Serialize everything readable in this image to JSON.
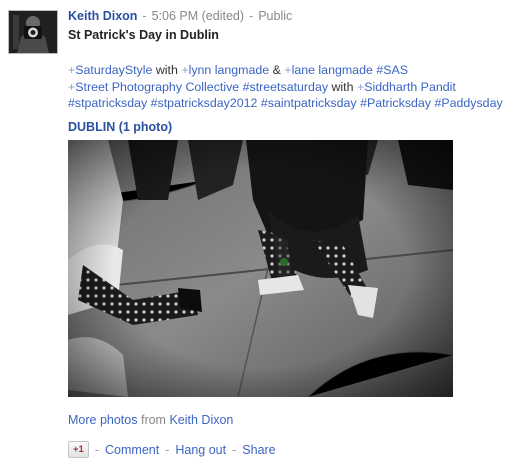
{
  "post": {
    "author": "Keith Dixon",
    "time": "5:06 PM (edited)",
    "visibility": "Public",
    "title": "St Patrick's Day in Dublin"
  },
  "tags": {
    "line1": [
      {
        "text": "+SaturdayStyle",
        "link": true
      },
      {
        "text": " with ",
        "link": false
      },
      {
        "text": "+lynn langmade",
        "link": true
      },
      {
        "text": " & ",
        "link": false
      },
      {
        "text": "+lane langmade",
        "link": true
      },
      {
        "text": " ",
        "link": false
      },
      {
        "text": "#SAS",
        "link": true
      }
    ],
    "line2": [
      {
        "text": "+Street Photography Collective",
        "link": true
      },
      {
        "text": " ",
        "link": false
      },
      {
        "text": "#streetsaturday",
        "link": true
      },
      {
        "text": " with ",
        "link": false
      },
      {
        "text": "+Siddharth Pandit",
        "link": true
      }
    ],
    "line3": [
      {
        "text": "#stpatricksday",
        "link": true
      },
      {
        "text": " ",
        "link": false
      },
      {
        "text": "#stpatricksday2012",
        "link": true
      },
      {
        "text": " ",
        "link": false
      },
      {
        "text": "#saintpatricksday",
        "link": true
      },
      {
        "text": " ",
        "link": false
      },
      {
        "text": "#Patricksday",
        "link": true
      },
      {
        "text": " ",
        "link": false
      },
      {
        "text": "#Paddysday",
        "link": true
      }
    ]
  },
  "album": {
    "label": "DUBLIN (1 photo)"
  },
  "more": {
    "link": "More photos",
    "from": "from",
    "author": "Keith Dixon"
  },
  "actions": {
    "plusone": "+1",
    "comment": "Comment",
    "hangout": "Hang out",
    "share": "Share",
    "separator": "-"
  },
  "icons": {
    "avatar": "camera-photographer-avatar-icon"
  },
  "colors": {
    "link": "#3b65c4",
    "author": "#2a50a0",
    "meta": "#888888",
    "plusone_text": "#a23333"
  }
}
